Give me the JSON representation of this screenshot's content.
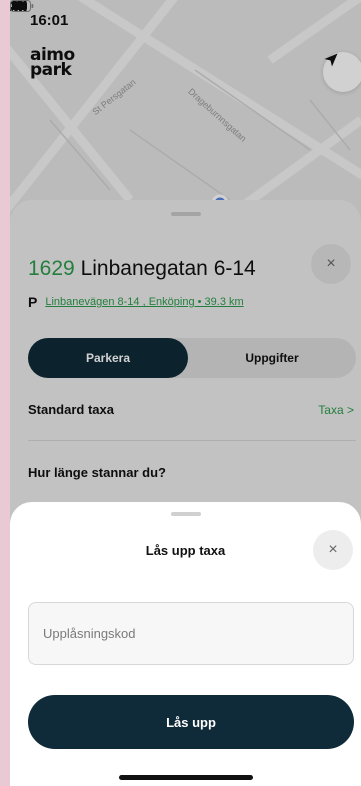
{
  "status_bar": {
    "time": "16:01",
    "icons": [
      "location-arrow-icon",
      "signal-icon",
      "wifi-icon",
      "battery-icon"
    ]
  },
  "map": {
    "logo_line1": "aimo",
    "logo_line2": "park",
    "street_labels": [
      "St Persgatan",
      "Drageburnnsgatan"
    ],
    "locate_icon": "navigation-arrow-icon"
  },
  "parking_sheet": {
    "zone_code": "1629",
    "zone_name": "Linbanegatan 6-14",
    "p_label": "P",
    "address_link": "Linbanevägen 8-14 , Enköping • 39.3 km",
    "close_label": "×",
    "tabs": [
      {
        "label": "Parkera",
        "active": true
      },
      {
        "label": "Uppgifter",
        "active": false
      }
    ],
    "tariff_label": "Standard taxa",
    "tariff_link": "Taxa >",
    "duration_question": "Hur länge stannar du?"
  },
  "unlock_modal": {
    "title": "Lås upp taxa",
    "close_label": "×",
    "code_placeholder": "Upplåsningskod",
    "code_value": "",
    "submit_label": "Lås upp"
  },
  "colors": {
    "accent_green": "#2c9c4c",
    "primary_dark": "#0f2a38",
    "backdrop": "#e9c9d3"
  }
}
